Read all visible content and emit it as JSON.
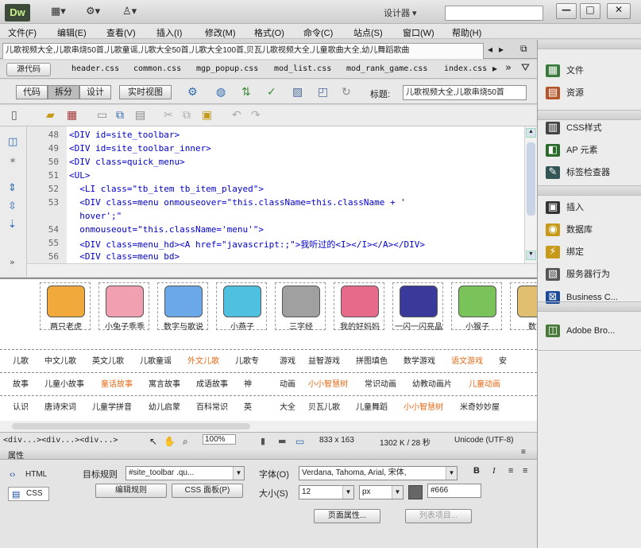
{
  "app": {
    "logo": "Dw",
    "workspace": "设计器 ▾",
    "search_value": ""
  },
  "window_buttons": {
    "minimize": "—",
    "maximize": "□",
    "close": "✕"
  },
  "menu": [
    "文件(F)",
    "编辑(E)",
    "查看(V)",
    "插入(I)",
    "修改(M)",
    "格式(O)",
    "命令(C)",
    "站点(S)",
    "窗口(W)",
    "帮助(H)"
  ],
  "doc_tab": "儿歌视频大全,儿歌串烧50首,儿歌童谣,儿歌大全50首,儿歌大全100首,贝瓦儿歌视频大全,儿童歌曲大全,幼儿舞蹈歌曲",
  "related_files": {
    "source": "源代码",
    "files": [
      "header.css",
      "common.css",
      "mgp_popup.css",
      "mod_list.css",
      "mod_rank_game.css",
      "index.css"
    ]
  },
  "doc_toolbar": {
    "views": [
      "代码",
      "拆分",
      "设计",
      "实时视图"
    ],
    "title_label": "标题:",
    "title_value": "儿歌视频大全,儿歌串烧50首"
  },
  "code": {
    "line_numbers": [
      "48",
      "49",
      "50",
      "51",
      "52",
      "53",
      "",
      "54",
      "55",
      "56"
    ],
    "lines": [
      "<DIV id=site_toolbar>",
      "<DIV id=site_toolbar_inner>",
      "<DIV class=quick_menu>",
      "<UL>",
      "  <LI class=\"tb_item tb_item_played\">",
      "  <DIV class=menu onmouseover=\"this.className=this.className + '",
      "  hover';\"",
      "  onmouseout=\"this.className='menu'\">",
      "  <DIV class=menu_hd><A href=\"javascript:;\">我听过的<I></I></A></DIV>",
      "  <DIV class=menu bd>"
    ]
  },
  "thumbs": [
    {
      "caption": "两只老虎",
      "color": "#f2a93b"
    },
    {
      "caption": "小兔子乖乖",
      "color": "#f0a0b0"
    },
    {
      "caption": "数字与歌说",
      "color": "#6aa8e8"
    },
    {
      "caption": "小燕子",
      "color": "#4fc0e0"
    },
    {
      "caption": "三字经",
      "color": "#a0a0a0"
    },
    {
      "caption": "我的好妈妈",
      "color": "#e86a8a"
    },
    {
      "caption": "一闪一闪亮晶",
      "color": "#3a3a9a"
    },
    {
      "caption": "小猴子",
      "color": "#7ac25a"
    },
    {
      "caption": "数字",
      "color": "#e0c070"
    }
  ],
  "design_rows": [
    {
      "left": [
        "儿歌",
        "中文儿歌",
        "英文儿歌",
        "儿歌童谣",
        "外文儿歌",
        "儿歌专"
      ],
      "right": [
        "游戏",
        "益智游戏",
        "拼图填色",
        "数学游戏",
        "语文游戏",
        "安"
      ]
    },
    {
      "left": [
        "故事",
        "儿童小故事",
        "童话故事",
        "寓言故事",
        "成语故事",
        "神"
      ],
      "right": [
        "动画",
        "小小智慧树",
        "常识动画",
        "幼教动画片",
        "儿童动画"
      ]
    },
    {
      "left": [
        "认识",
        "唐诗宋词",
        "儿童学拼音",
        "幼儿启蒙",
        "百科常识",
        "英"
      ],
      "right": [
        "大全",
        "贝瓦儿歌",
        "儿童舞蹈",
        "小小智慧树",
        "米奇妙妙屋"
      ]
    }
  ],
  "status": {
    "tags": "<div...><div...><div...>",
    "zoom": "100%",
    "dims": "833 x 163",
    "size": "1302 K / 28 秒",
    "encoding": "Unicode (UTF-8)"
  },
  "properties": {
    "header": "属性",
    "html_label": "HTML",
    "css_label": "CSS",
    "target_rule_label": "目标规则",
    "target_rule_value": "#site_toolbar .qu...",
    "edit_rule": "编辑规则",
    "css_panel": "CSS 面板(P)",
    "font_label": "字体(O)",
    "font_value": "Verdana, Tahoma, Arial, 宋体,",
    "size_label": "大小(S)",
    "size_value": "12",
    "unit_value": "px",
    "color_value": "#666",
    "page_props": "页面属性...",
    "list_item": "列表项目..."
  },
  "panels": [
    {
      "label": "文件",
      "color": "#3a7a3a",
      "glyph": "▦"
    },
    {
      "label": "资源",
      "color": "#b5562a",
      "glyph": "▤"
    },
    {
      "label": "CSS样式",
      "color": "#444",
      "glyph": "▥"
    },
    {
      "label": "AP 元素",
      "color": "#2a6a2a",
      "glyph": "◧"
    },
    {
      "label": "标签检查器",
      "color": "#355",
      "glyph": "✎"
    },
    {
      "label": "插入",
      "color": "#333",
      "glyph": "▣"
    },
    {
      "label": "数据库",
      "color": "#c79a1a",
      "glyph": "◉"
    },
    {
      "label": "绑定",
      "color": "#c79a1a",
      "glyph": "⚡"
    },
    {
      "label": "服务器行为",
      "color": "#555",
      "glyph": "▧"
    },
    {
      "label": "Business C...",
      "color": "#1a4a9a",
      "glyph": "⊠"
    },
    {
      "label": "Adobe Bro...",
      "color": "#4a7a3a",
      "glyph": "◫"
    }
  ]
}
